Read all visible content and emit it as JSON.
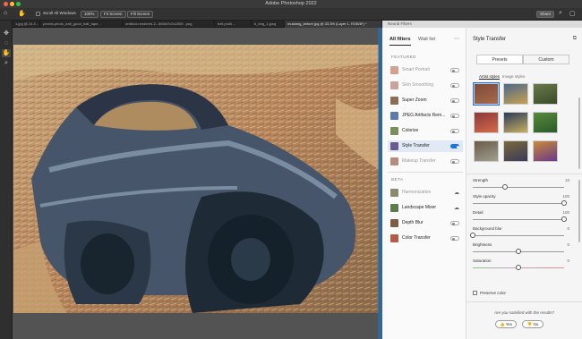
{
  "window": {
    "title": "Adobe Photoshop 2022",
    "traffic_colors": [
      "#ff5f57",
      "#febc2e",
      "#28c840"
    ],
    "share_label": "Share"
  },
  "options_bar": {
    "scroll_all_windows": "Scroll All Windows",
    "zoom_100": "100%",
    "fit_screen": "Fit Screen",
    "fill_screen": "Fill Screen"
  },
  "doc_tabs": [
    "1.jpg @ 24.4...",
    "pexels-photo_half_good_halt_tape...",
    "untitled-rendered-2...86f4d7c0c20f2f...png",
    "bell.psd0 ...",
    "b_beg_1.jpeg",
    "mustang_before.jpg @ 33.3% (Layer 1, RGB/8*) *"
  ],
  "panel": {
    "title": "Neural Filters",
    "all_filters": "All filters",
    "wait_list": "Wait list"
  },
  "featured": {
    "label": "FEATURED",
    "items": [
      {
        "label": "Smart Portrait",
        "dim": true,
        "on": false,
        "color": "#d4a190"
      },
      {
        "label": "Skin Smoothing",
        "dim": true,
        "on": false,
        "color": "#c9a49a"
      },
      {
        "label": "Super Zoom",
        "dim": false,
        "on": false,
        "color": "#8a6d54"
      },
      {
        "label": "JPEG Artifacts Rem...",
        "dim": false,
        "on": false,
        "color": "#5a7ca8"
      },
      {
        "label": "Colorize",
        "dim": false,
        "on": false,
        "color": "#7c8f5a"
      },
      {
        "label": "Style Transfer",
        "dim": false,
        "on": true,
        "color": "#6c5b8f"
      },
      {
        "label": "Makeup Transfer",
        "dim": true,
        "on": false,
        "color": "#b68b7f"
      }
    ]
  },
  "beta": {
    "label": "BETA",
    "items": [
      {
        "label": "Harmonization",
        "dim": true,
        "cloud": true,
        "color": "#8a8a70"
      },
      {
        "label": "Landscape Mixer",
        "dim": false,
        "cloud": true,
        "color": "#5d7b4c"
      },
      {
        "label": "Depth Blur",
        "dim": false,
        "on": false,
        "color": "#7d5f46"
      },
      {
        "label": "Color Transfer",
        "dim": false,
        "on": false,
        "color": "#b55a4a"
      }
    ]
  },
  "detail": {
    "title": "Style Transfer",
    "presets": "Presets",
    "custom": "Custom",
    "artist_styles": "Artist styles",
    "image_styles": "Image styles",
    "swatches": [
      [
        "#7d4a3a",
        "#a86a4a"
      ],
      [
        "#4a6a8a",
        "#c8a050"
      ],
      [
        "#6a7a4a",
        "#3a4a2a"
      ],
      [
        "#8a3a3a",
        "#d46a4a"
      ],
      [
        "#2a3a5a",
        "#c8b060"
      ],
      [
        "#5a8a3a",
        "#2a5a2a"
      ],
      [
        "#6a5a4a",
        "#a0a090"
      ],
      [
        "#7a6a3a",
        "#3a3a5a"
      ],
      [
        "#c88a3a",
        "#6a3a8a"
      ]
    ],
    "sliders": [
      {
        "label": "Strength",
        "value": "10",
        "frac": 0.35
      },
      {
        "label": "Style opacity",
        "value": "100",
        "frac": 1.0
      },
      {
        "label": "Detail",
        "value": "100",
        "frac": 1.0
      },
      {
        "label": "Background blur",
        "value": "0",
        "frac": 0.0
      },
      {
        "label": "Brightness",
        "value": "0",
        "frac": 0.5
      },
      {
        "label": "Saturation",
        "value": "0",
        "frac": 0.5
      }
    ],
    "preserve_color": "Preserve color",
    "question": "Are you satisfied with the results?",
    "yes": "Yes",
    "no": "No"
  }
}
